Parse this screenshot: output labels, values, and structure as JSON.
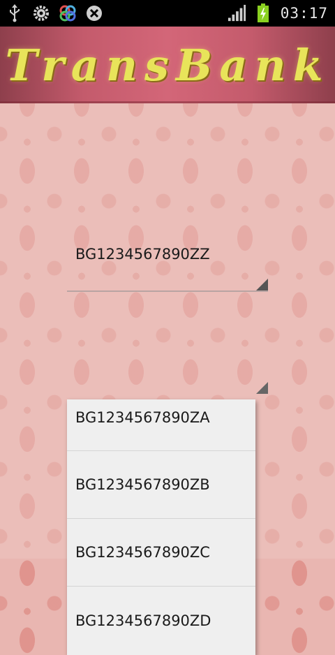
{
  "status_bar": {
    "time": "03:17",
    "icons_left": [
      "usb-icon",
      "gear-icon",
      "app-icon",
      "close-icon"
    ],
    "icons_right": [
      "signal-icon",
      "battery-charging-icon"
    ]
  },
  "header": {
    "logo_text": "TransBank"
  },
  "spinner": {
    "selected": "BG1234567890ZZ"
  },
  "dropdown": {
    "items": [
      "BG1234567890ZA",
      "BG1234567890ZB",
      "BG1234567890ZC",
      "BG1234567890ZD"
    ]
  }
}
